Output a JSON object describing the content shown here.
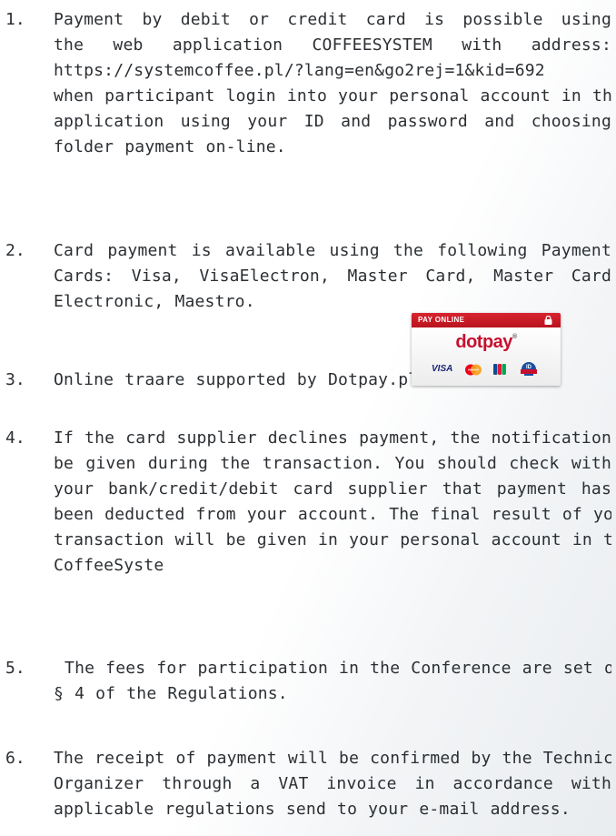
{
  "items": [
    {
      "number": "1.",
      "lines": [
        "Payment by debit or credit card is possible using",
        "the web application COFFEESYSTEM with address:",
        "https://systemcoffee.pl/?lang=en&go2rej=1&kid=692",
        "when participant login into your personal account in this",
        "application using your ID and password and choosing",
        "folder payment on-line."
      ]
    },
    {
      "number": "2.",
      "lines": [
        "Card payment is available using the following Payment",
        "Cards: Visa, VisaElectron, Master Card, Master Card",
        "Electronic, Maestro."
      ]
    },
    {
      "number": "3.",
      "lines": [
        "Online traare supported by Dotpay.pl"
      ]
    },
    {
      "number": "4.",
      "lines": [
        "If the card supplier declines payment, the notification will",
        "be given during the transaction. You should check with",
        "your bank/credit/debit card supplier that payment has",
        "been deducted from your account. The final result of your",
        "transaction will be given in your personal account in the",
        "CoffeeSyste"
      ]
    },
    {
      "number": "5.",
      "lines": [
        " The fees for participation in the Conference are set out in",
        "§ 4 of the Regulations."
      ]
    },
    {
      "number": "6.",
      "lines": [
        "The receipt of payment will be confirmed by the Technical",
        "Organizer through a VAT invoice in accordance with",
        "applicable regulations send to your e-mail address."
      ]
    }
  ],
  "badge": {
    "header": "PAY ONLINE",
    "logo": "dotpay",
    "logo_mark": "®",
    "cards": [
      "VISA",
      "mastercard-icon",
      "jcb-icon",
      "id-icon"
    ],
    "visa_label": "VISA",
    "header_color": "#c8102e"
  }
}
